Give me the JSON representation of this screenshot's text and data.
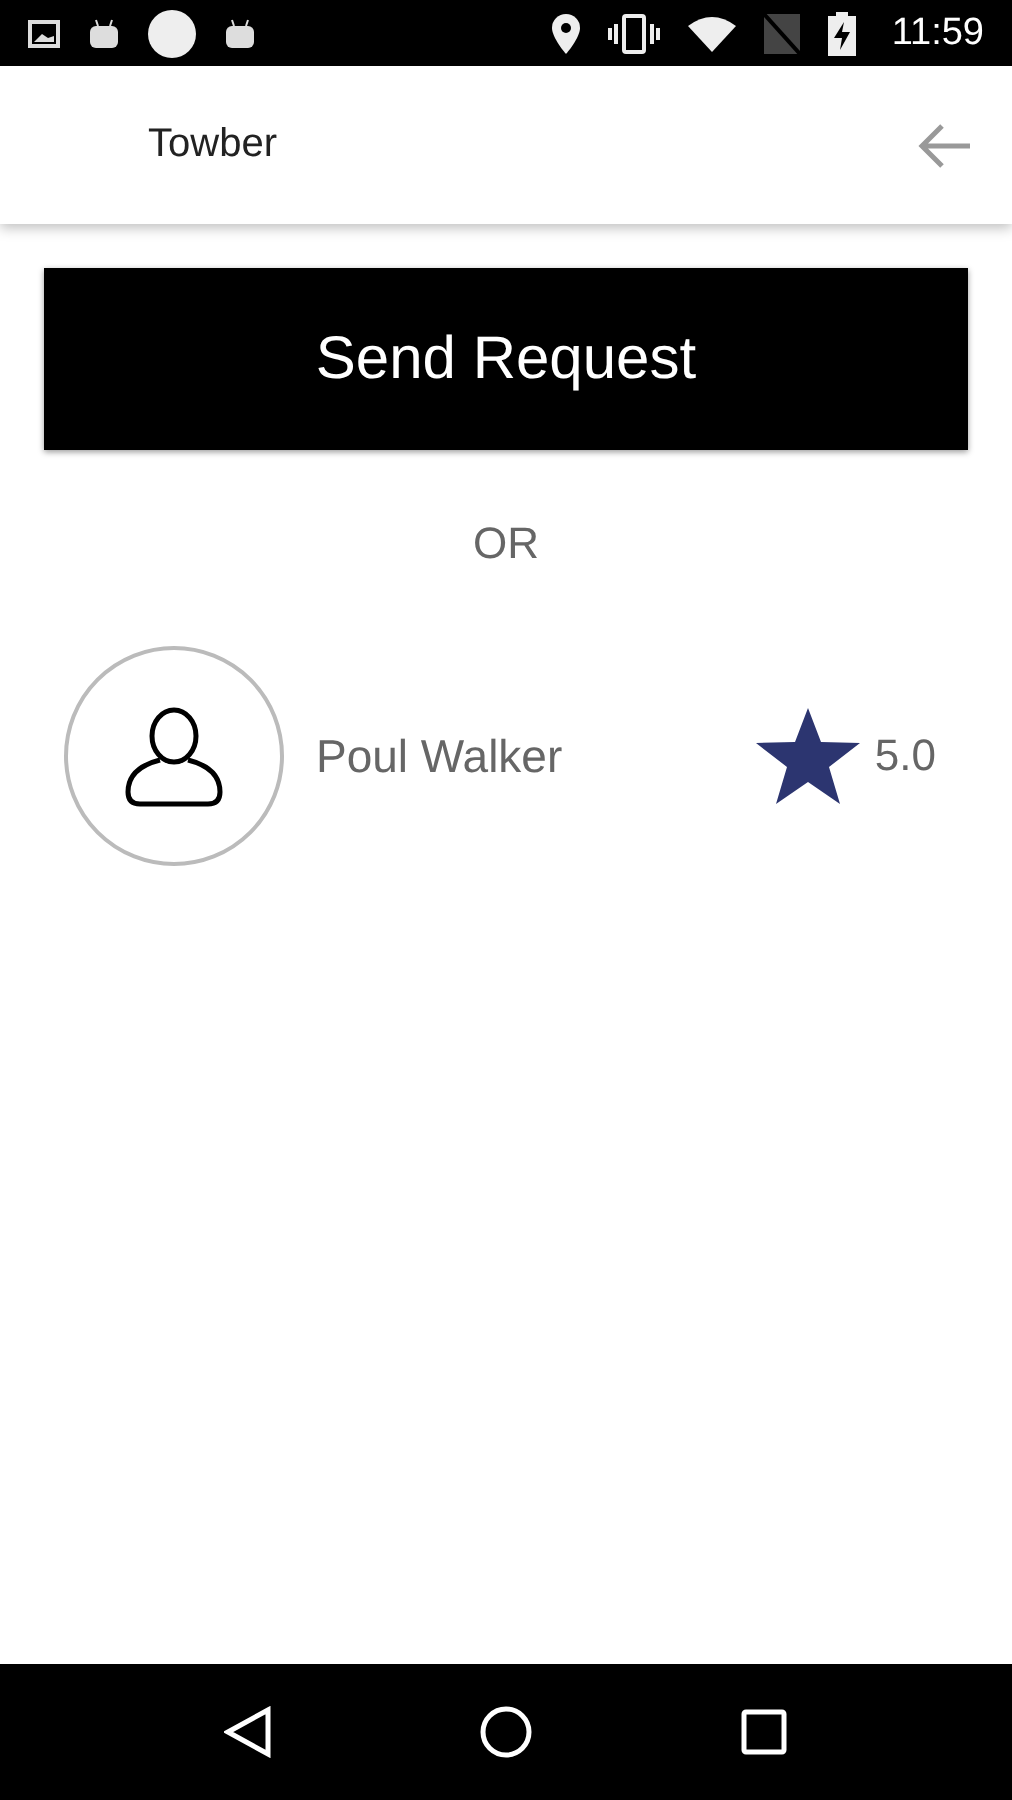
{
  "status_bar": {
    "time": "11:59"
  },
  "app_bar": {
    "title": "Towber"
  },
  "send_button": {
    "label": "Send Request"
  },
  "divider_text": "OR",
  "driver": {
    "name": "Poul Walker",
    "rating": "5.0"
  }
}
